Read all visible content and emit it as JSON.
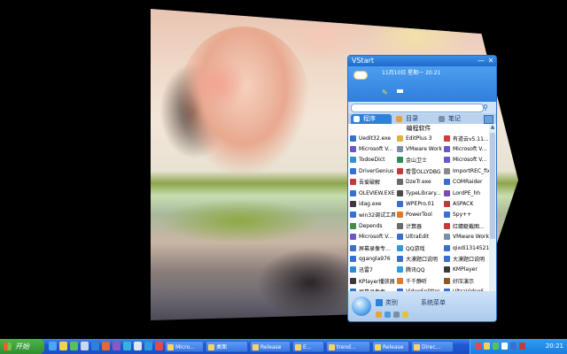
{
  "wallpaper": {
    "caption_text": ""
  },
  "vstart": {
    "title": "VStart",
    "min_label": "—",
    "close_label": "✕",
    "date_line": "11月10日 星期一 20:21",
    "search_placeholder": "",
    "tabs": [
      {
        "label": "程序",
        "active": true,
        "color": "#ffffff"
      },
      {
        "label": "目录",
        "active": false,
        "color": "#e2a33a"
      },
      {
        "label": "笔记",
        "active": false,
        "color": "#7c8fa9"
      }
    ],
    "section_title": "编程软件",
    "items": [
      {
        "label": "Uedit32.exe",
        "color": "#3a6fcf"
      },
      {
        "label": "EditPlus 3",
        "color": "#e0b23c"
      },
      {
        "label": "有道云v5.11...",
        "color": "#d83b3b"
      },
      {
        "label": "Microsoft V...",
        "color": "#6b58c4"
      },
      {
        "label": "VMware Work...",
        "color": "#7a8fa6"
      },
      {
        "label": "Microsoft V...",
        "color": "#6b58c4"
      },
      {
        "label": "TodoeDict",
        "color": "#3b8fd0"
      },
      {
        "label": "金山卫士",
        "color": "#2e8b57"
      },
      {
        "label": "Microsoft V...",
        "color": "#6b58c4"
      },
      {
        "label": "DriverGenius",
        "color": "#3a6fcf"
      },
      {
        "label": "看雪OLLYDBG",
        "color": "#c43a3a"
      },
      {
        "label": "ImportREC_fix",
        "color": "#8a8a8a"
      },
      {
        "label": "吾爱破解",
        "color": "#c43a3a"
      },
      {
        "label": "DzeTr.exe",
        "color": "#6a6a6a"
      },
      {
        "label": "COMRaider",
        "color": "#3a6fcf"
      },
      {
        "label": "OLEVIEW.EXE",
        "color": "#3a6fcf"
      },
      {
        "label": "TypeLibrary...",
        "color": "#4a4a4a"
      },
      {
        "label": "LordPE_hh",
        "color": "#7a4ab0"
      },
      {
        "label": "idag.exe",
        "color": "#3a3a3a"
      },
      {
        "label": "WPEPro.01",
        "color": "#3a6fcf"
      },
      {
        "label": "ASPACK",
        "color": "#c43a3a"
      },
      {
        "label": "win32调试工具",
        "color": "#3a6fcf"
      },
      {
        "label": "PowerTool",
        "color": "#e07a2a"
      },
      {
        "label": "Spy++",
        "color": "#3a6fcf"
      },
      {
        "label": "Depends",
        "color": "#4a8a4a"
      },
      {
        "label": "计算器",
        "color": "#6a6a6a"
      },
      {
        "label": "红蜻蜓截图...",
        "color": "#c43a3a"
      },
      {
        "label": "Microsoft V...",
        "color": "#6b58c4"
      },
      {
        "label": "UltraEdit",
        "color": "#3a6fcf"
      },
      {
        "label": "VMware Work...",
        "color": "#7a8fa6"
      },
      {
        "label": "屏幕录像专...",
        "color": "#3a6fcf"
      },
      {
        "label": "QQ游戏",
        "color": "#2e9be0"
      },
      {
        "label": "qixdi1314521",
        "color": "#3a6fcf"
      },
      {
        "label": "qgangla976",
        "color": "#3a6fcf"
      },
      {
        "label": "大漠题口说明",
        "color": "#3a6fcf"
      },
      {
        "label": "大漠题口说明",
        "color": "#3a6fcf"
      },
      {
        "label": "迅雷7",
        "color": "#2e8bd8"
      },
      {
        "label": "腾讯QQ",
        "color": "#2e9be0"
      },
      {
        "label": "KMPlayer",
        "color": "#3a3a3a"
      },
      {
        "label": "KPlayer播放器",
        "color": "#3a3a3a"
      },
      {
        "label": "千千静听",
        "color": "#e07a2a"
      },
      {
        "label": "好压演示",
        "color": "#8a5a2a"
      },
      {
        "label": "屏幕录像专...",
        "color": "#3a6fcf"
      },
      {
        "label": "VideoSplitter",
        "color": "#3a6fcf"
      },
      {
        "label": "UltraVideoS...",
        "color": "#3a6fcf"
      }
    ],
    "footer": {
      "types_label": "类别",
      "menu_label": "系统菜单"
    }
  },
  "taskbar": {
    "start_label": "开始",
    "tasks": [
      {
        "label": "Micro..."
      },
      {
        "label": "桌面"
      },
      {
        "label": "Release"
      },
      {
        "label": "E..."
      },
      {
        "label": "trend..."
      },
      {
        "label": "Release"
      },
      {
        "label": "Direc..."
      }
    ],
    "clock": "20:21"
  }
}
